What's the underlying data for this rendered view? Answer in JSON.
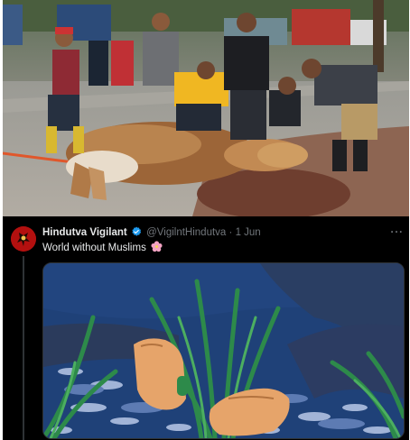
{
  "tweet": {
    "display_name": "Hindutva Vigilant",
    "handle": "@VigilntHindutva",
    "separator": "·",
    "date": "1 Jun",
    "more": "···",
    "text": "World without Muslims",
    "emoji": "cherry-blossom-icon"
  },
  "icons": {
    "verified": "verified-badge-icon",
    "avatar": "avatar-logo-icon",
    "more": "more-options-icon"
  },
  "colors": {
    "background_dark": "#000000",
    "text_primary": "#e7e9ea",
    "text_secondary": "#71767b",
    "verified_blue": "#1d9bf0",
    "flower_pink": "#f4a3c3"
  }
}
